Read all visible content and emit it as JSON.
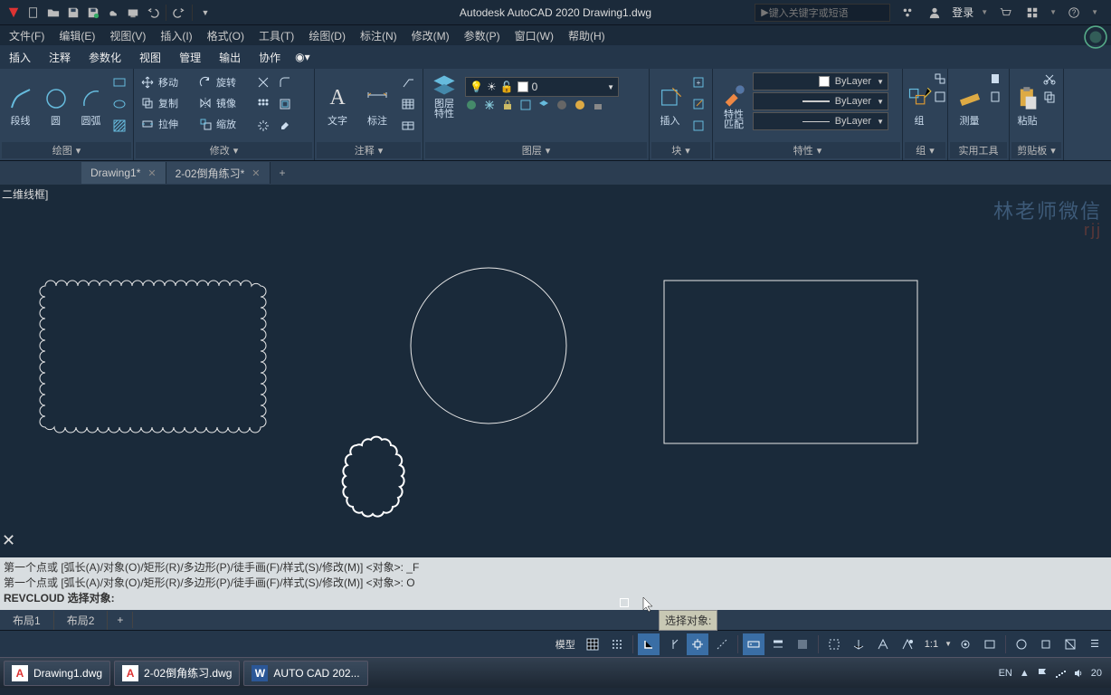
{
  "app": {
    "title": "Autodesk AutoCAD 2020   Drawing1.dwg",
    "search_placeholder": "键入关键字或短语",
    "login": "登录"
  },
  "menubar": [
    "文件(F)",
    "编辑(E)",
    "视图(V)",
    "插入(I)",
    "格式(O)",
    "工具(T)",
    "绘图(D)",
    "标注(N)",
    "修改(M)",
    "参数(P)",
    "窗口(W)",
    "帮助(H)"
  ],
  "ribbon_tabs": [
    "插入",
    "注释",
    "参数化",
    "视图",
    "管理",
    "输出",
    "协作"
  ],
  "panels": {
    "draw": {
      "label": "绘图",
      "line": "段线",
      "circle": "圆",
      "arc": "圆弧"
    },
    "modify": {
      "label": "修改",
      "move": "移动",
      "copy": "复制",
      "stretch": "拉伸",
      "rotate": "旋转",
      "mirror": "镜像",
      "scale": "缩放"
    },
    "annotation": {
      "label": "注释",
      "text": "文字",
      "dim": "标注"
    },
    "layer": {
      "label": "图层",
      "props": "图层\n特性",
      "current": "0"
    },
    "block": {
      "label": "块",
      "insert": "插入"
    },
    "properties": {
      "label": "特性",
      "match": "特性\n匹配",
      "bylayer": "ByLayer"
    },
    "group": {
      "label": "组",
      "btn": "组"
    },
    "utility": {
      "label": "实用工具",
      "measure": "测量"
    },
    "clipboard": {
      "label": "剪贴板",
      "paste": "粘贴"
    }
  },
  "doc_tabs": [
    {
      "name": "Drawing1*",
      "active": true
    },
    {
      "name": "2-02倒角练习*",
      "active": false
    }
  ],
  "view_label": "二维线框]",
  "watermark": "林老师微信",
  "watermark_sub": "rjj",
  "tooltip": "选择对象:",
  "cmd_lines": [
    "第一个点或 [弧长(A)/对象(O)/矩形(R)/多边形(P)/徒手画(F)/样式(S)/修改(M)] <对象>: _F",
    "第一个点或 [弧长(A)/对象(O)/矩形(R)/多边形(P)/徒手画(F)/样式(S)/修改(M)] <对象>: O"
  ],
  "cmd_prompt": "REVCLOUD 选择对象:",
  "layout_tabs": [
    "布局1",
    "布局2"
  ],
  "statusbar": {
    "model": "模型",
    "scale": "1:1"
  },
  "taskbar": {
    "items": [
      {
        "icon": "A",
        "color": "#d33",
        "label": "Drawing1.dwg"
      },
      {
        "icon": "A",
        "color": "#d33",
        "label": "2-02倒角练习.dwg"
      },
      {
        "icon": "W",
        "color": "#2b5797",
        "label": "AUTO  CAD 202..."
      }
    ],
    "lang": "EN",
    "time": "20"
  }
}
